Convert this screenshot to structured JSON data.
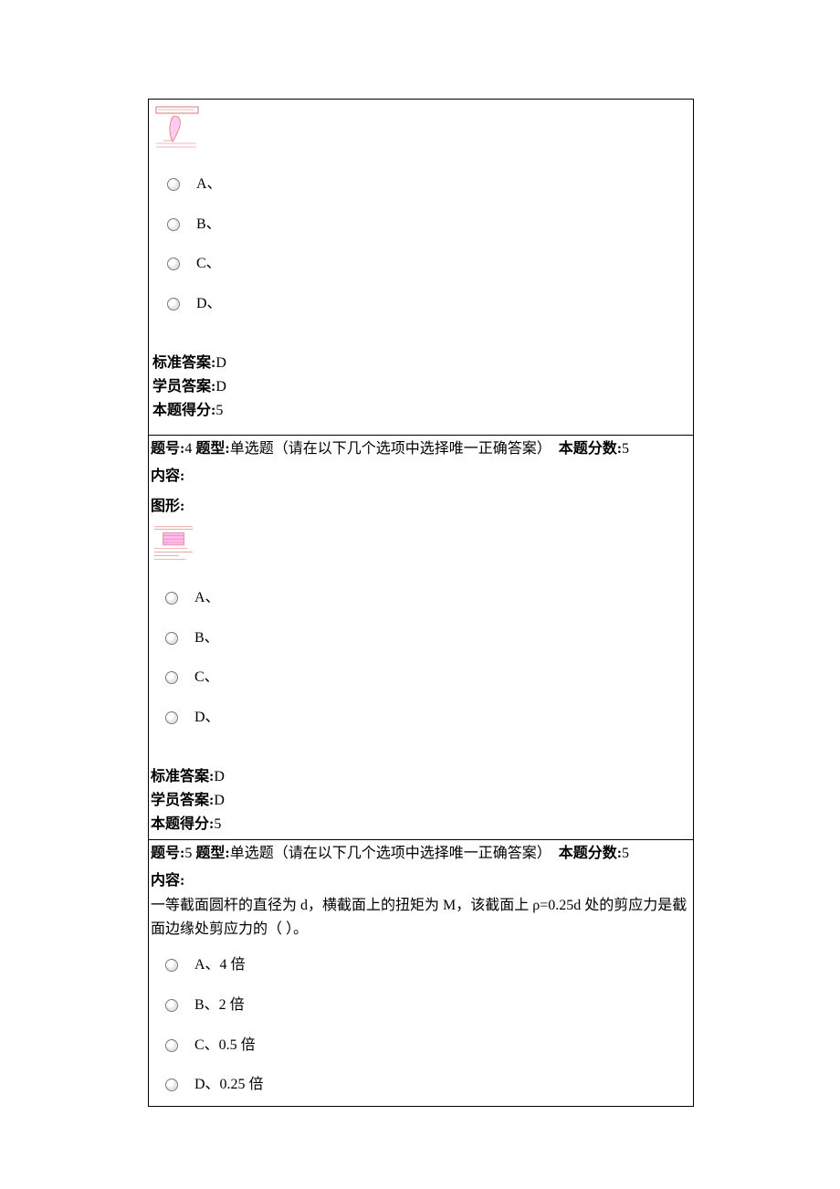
{
  "q3": {
    "figure_label": "",
    "options": {
      "a": "A、",
      "b": "B、",
      "c": "C、",
      "d": "D、"
    },
    "std_answer_label": "标准答案:",
    "std_answer": "D",
    "student_answer_label": "学员答案:",
    "student_answer": "D",
    "score_label": "本题得分:",
    "score": "5"
  },
  "q4": {
    "num_label": "题号:",
    "num": "4",
    "type_label": "题型:",
    "type_text": "单选题（请在以下几个选项中选择唯一正确答案）",
    "points_label": "本题分数:",
    "points": "5",
    "content_label": "内容:",
    "content_text": "",
    "figure_label": "图形:",
    "options": {
      "a": "A、",
      "b": "B、",
      "c": "C、",
      "d": "D、"
    },
    "std_answer_label": "标准答案:",
    "std_answer": "D",
    "student_answer_label": "学员答案:",
    "student_answer": "D",
    "score_label": "本题得分:",
    "score": "5"
  },
  "q5": {
    "num_label": "题号:",
    "num": "5",
    "type_label": "题型:",
    "type_text": "单选题（请在以下几个选项中选择唯一正确答案）",
    "points_label": "本题分数:",
    "points": "5",
    "content_label": "内容:",
    "content_text": "一等截面圆杆的直径为 d，横截面上的扭矩为 M，该截面上 ρ=0.25d 处的剪应力是截面边缘处剪应力的（ ）。",
    "options": {
      "a": "A、4 倍",
      "b": "B、2 倍",
      "c": "C、0.5 倍",
      "d": "D、0.25 倍"
    }
  }
}
